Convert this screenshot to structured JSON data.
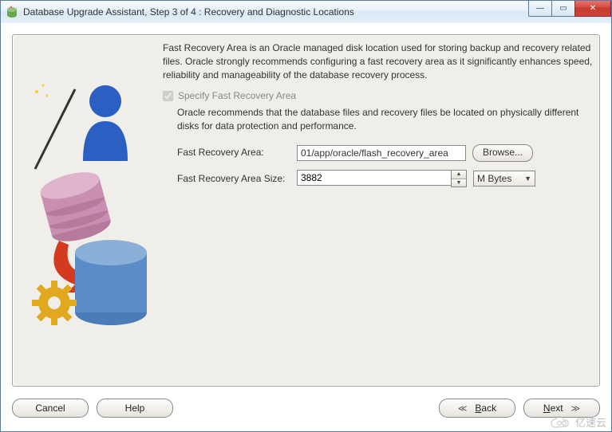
{
  "window": {
    "title": "Database Upgrade Assistant, Step 3 of 4 : Recovery and Diagnostic Locations"
  },
  "window_controls": {
    "min_glyph": "—",
    "max_glyph": "▭",
    "close_glyph": "✕"
  },
  "content": {
    "intro": "Fast Recovery Area is an Oracle managed disk location used for storing backup and recovery related files. Oracle strongly recommends configuring a fast recovery area as it significantly enhances speed, reliability and manageability of the database recovery process.",
    "checkbox_label": "Specify Fast Recovery Area",
    "checkbox_checked": true,
    "sub_desc": "Oracle recommends that the database files and recovery files be located on physically different disks for data protection and performance.",
    "path_label": "Fast Recovery Area:",
    "path_value_prefix": "01/app/ora",
    "path_value_selected": "cle/flash_recovery_area",
    "browse_label": "Browse...",
    "size_label": "Fast Recovery Area Size:",
    "size_value": "3882",
    "unit_selected": "M Bytes"
  },
  "buttons": {
    "cancel": "Cancel",
    "help": "Help",
    "back_arrow": "≪",
    "back_prefix": "B",
    "back_rest": "ack",
    "next_prefix": "N",
    "next_rest": "ext",
    "next_arrow": "≫"
  },
  "watermark": {
    "text": "亿速云"
  }
}
